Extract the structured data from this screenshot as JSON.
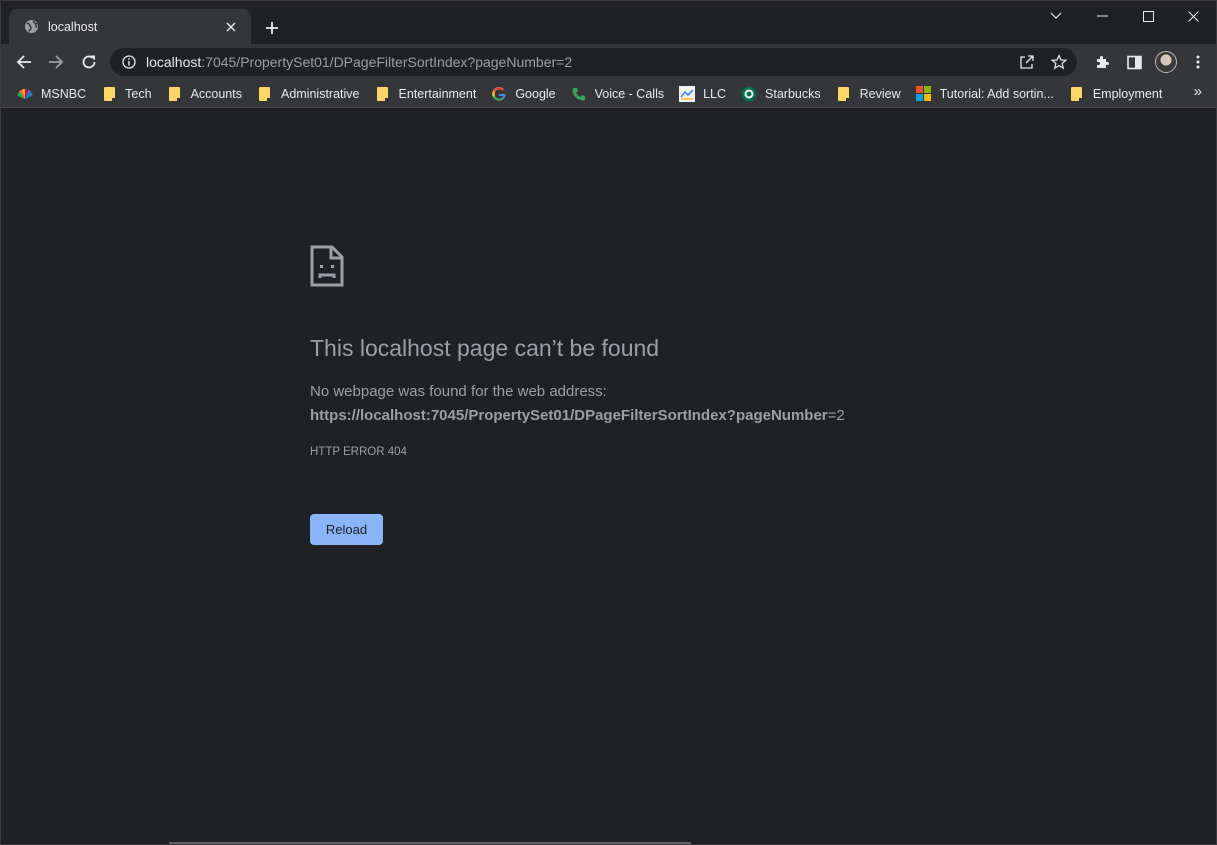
{
  "tab": {
    "title": "localhost"
  },
  "omnibox": {
    "url_host": "localhost",
    "url_rest": ":7045/PropertySet01/DPageFilterSortIndex?pageNumber=2"
  },
  "bookmarks": [
    {
      "label": "MSNBC",
      "icon": "msnbc-icon"
    },
    {
      "label": "Tech",
      "icon": "folder-icon"
    },
    {
      "label": "Accounts",
      "icon": "folder-icon"
    },
    {
      "label": "Administrative",
      "icon": "folder-icon"
    },
    {
      "label": "Entertainment",
      "icon": "folder-icon"
    },
    {
      "label": "Google",
      "icon": "google-icon"
    },
    {
      "label": "Voice - Calls",
      "icon": "phone-icon"
    },
    {
      "label": "LLC",
      "icon": "llc-icon"
    },
    {
      "label": "Starbucks",
      "icon": "starbucks-icon"
    },
    {
      "label": "Review",
      "icon": "folder-icon"
    },
    {
      "label": "Tutorial: Add sortin...",
      "icon": "microsoft-icon"
    },
    {
      "label": "Employment",
      "icon": "folder-icon"
    }
  ],
  "bookmarks_more": "»",
  "page": {
    "headline": "This localhost page can’t be found",
    "description": "No webpage was found for the web address:",
    "url_bold": "https://localhost:7045/PropertySet01/DPageFilterSortIndex?pageNumber",
    "url_tail": "=2",
    "error_code": "HTTP ERROR 404",
    "reload_label": "Reload"
  },
  "colors": {
    "background": "#202124",
    "toolbar": "#35363a",
    "text_muted": "#9aa0a6",
    "accent": "#8ab4f8",
    "folder": "#fdd663"
  }
}
